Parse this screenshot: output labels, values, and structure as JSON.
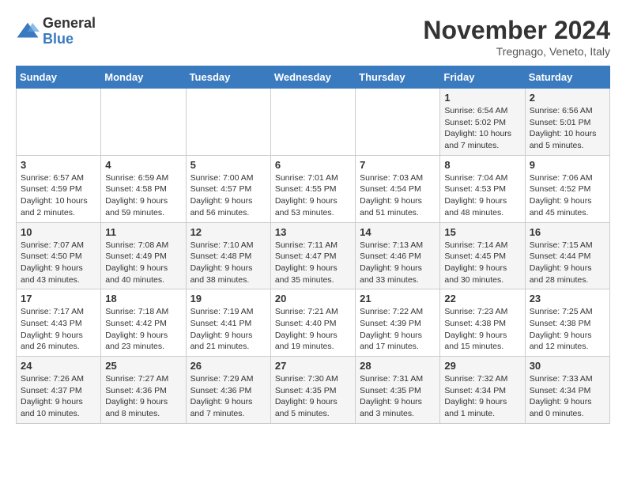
{
  "header": {
    "logo_general": "General",
    "logo_blue": "Blue",
    "month_title": "November 2024",
    "location": "Tregnago, Veneto, Italy"
  },
  "days_of_week": [
    "Sunday",
    "Monday",
    "Tuesday",
    "Wednesday",
    "Thursday",
    "Friday",
    "Saturday"
  ],
  "weeks": [
    [
      {
        "day": "",
        "info": ""
      },
      {
        "day": "",
        "info": ""
      },
      {
        "day": "",
        "info": ""
      },
      {
        "day": "",
        "info": ""
      },
      {
        "day": "",
        "info": ""
      },
      {
        "day": "1",
        "info": "Sunrise: 6:54 AM\nSunset: 5:02 PM\nDaylight: 10 hours and 7 minutes."
      },
      {
        "day": "2",
        "info": "Sunrise: 6:56 AM\nSunset: 5:01 PM\nDaylight: 10 hours and 5 minutes."
      }
    ],
    [
      {
        "day": "3",
        "info": "Sunrise: 6:57 AM\nSunset: 4:59 PM\nDaylight: 10 hours and 2 minutes."
      },
      {
        "day": "4",
        "info": "Sunrise: 6:59 AM\nSunset: 4:58 PM\nDaylight: 9 hours and 59 minutes."
      },
      {
        "day": "5",
        "info": "Sunrise: 7:00 AM\nSunset: 4:57 PM\nDaylight: 9 hours and 56 minutes."
      },
      {
        "day": "6",
        "info": "Sunrise: 7:01 AM\nSunset: 4:55 PM\nDaylight: 9 hours and 53 minutes."
      },
      {
        "day": "7",
        "info": "Sunrise: 7:03 AM\nSunset: 4:54 PM\nDaylight: 9 hours and 51 minutes."
      },
      {
        "day": "8",
        "info": "Sunrise: 7:04 AM\nSunset: 4:53 PM\nDaylight: 9 hours and 48 minutes."
      },
      {
        "day": "9",
        "info": "Sunrise: 7:06 AM\nSunset: 4:52 PM\nDaylight: 9 hours and 45 minutes."
      }
    ],
    [
      {
        "day": "10",
        "info": "Sunrise: 7:07 AM\nSunset: 4:50 PM\nDaylight: 9 hours and 43 minutes."
      },
      {
        "day": "11",
        "info": "Sunrise: 7:08 AM\nSunset: 4:49 PM\nDaylight: 9 hours and 40 minutes."
      },
      {
        "day": "12",
        "info": "Sunrise: 7:10 AM\nSunset: 4:48 PM\nDaylight: 9 hours and 38 minutes."
      },
      {
        "day": "13",
        "info": "Sunrise: 7:11 AM\nSunset: 4:47 PM\nDaylight: 9 hours and 35 minutes."
      },
      {
        "day": "14",
        "info": "Sunrise: 7:13 AM\nSunset: 4:46 PM\nDaylight: 9 hours and 33 minutes."
      },
      {
        "day": "15",
        "info": "Sunrise: 7:14 AM\nSunset: 4:45 PM\nDaylight: 9 hours and 30 minutes."
      },
      {
        "day": "16",
        "info": "Sunrise: 7:15 AM\nSunset: 4:44 PM\nDaylight: 9 hours and 28 minutes."
      }
    ],
    [
      {
        "day": "17",
        "info": "Sunrise: 7:17 AM\nSunset: 4:43 PM\nDaylight: 9 hours and 26 minutes."
      },
      {
        "day": "18",
        "info": "Sunrise: 7:18 AM\nSunset: 4:42 PM\nDaylight: 9 hours and 23 minutes."
      },
      {
        "day": "19",
        "info": "Sunrise: 7:19 AM\nSunset: 4:41 PM\nDaylight: 9 hours and 21 minutes."
      },
      {
        "day": "20",
        "info": "Sunrise: 7:21 AM\nSunset: 4:40 PM\nDaylight: 9 hours and 19 minutes."
      },
      {
        "day": "21",
        "info": "Sunrise: 7:22 AM\nSunset: 4:39 PM\nDaylight: 9 hours and 17 minutes."
      },
      {
        "day": "22",
        "info": "Sunrise: 7:23 AM\nSunset: 4:38 PM\nDaylight: 9 hours and 15 minutes."
      },
      {
        "day": "23",
        "info": "Sunrise: 7:25 AM\nSunset: 4:38 PM\nDaylight: 9 hours and 12 minutes."
      }
    ],
    [
      {
        "day": "24",
        "info": "Sunrise: 7:26 AM\nSunset: 4:37 PM\nDaylight: 9 hours and 10 minutes."
      },
      {
        "day": "25",
        "info": "Sunrise: 7:27 AM\nSunset: 4:36 PM\nDaylight: 9 hours and 8 minutes."
      },
      {
        "day": "26",
        "info": "Sunrise: 7:29 AM\nSunset: 4:36 PM\nDaylight: 9 hours and 7 minutes."
      },
      {
        "day": "27",
        "info": "Sunrise: 7:30 AM\nSunset: 4:35 PM\nDaylight: 9 hours and 5 minutes."
      },
      {
        "day": "28",
        "info": "Sunrise: 7:31 AM\nSunset: 4:35 PM\nDaylight: 9 hours and 3 minutes."
      },
      {
        "day": "29",
        "info": "Sunrise: 7:32 AM\nSunset: 4:34 PM\nDaylight: 9 hours and 1 minute."
      },
      {
        "day": "30",
        "info": "Sunrise: 7:33 AM\nSunset: 4:34 PM\nDaylight: 9 hours and 0 minutes."
      }
    ]
  ]
}
